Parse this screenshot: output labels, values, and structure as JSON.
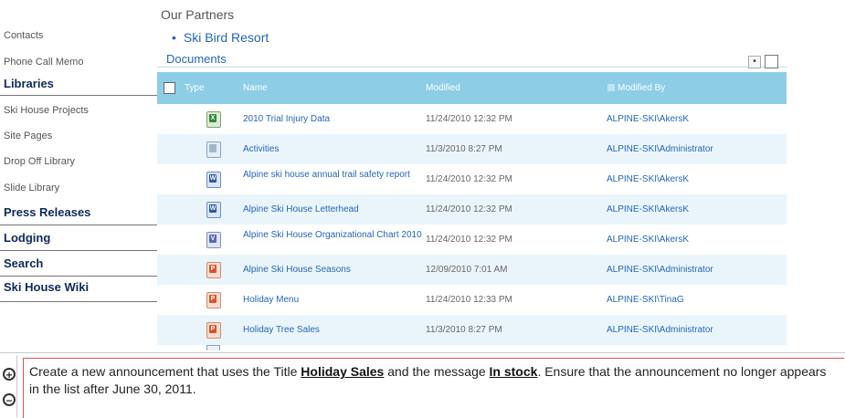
{
  "nav": {
    "contacts": "Contacts",
    "phone_call_memo": "Phone Call Memo",
    "libraries": "Libraries",
    "ski_house_projects": "Ski House Projects",
    "site_pages": "Site Pages",
    "drop_off_library": "Drop Off Library",
    "slide_library": "Slide Library",
    "press_releases": "Press Releases",
    "lodging": "Lodging",
    "search": "Search",
    "ski_house_wiki": "Ski House Wiki"
  },
  "partners": {
    "title": "Our Partners",
    "bullet": "•",
    "link": "Ski Bird Resort"
  },
  "documents": {
    "title": "Documents",
    "dot_control": "•",
    "columns": [
      "Type",
      "Name",
      "Modified",
      "Modified By"
    ],
    "rows": [
      {
        "icon": "excel-file-icon",
        "name": "2010 Trial Injury Data",
        "modified": "11/24/2010 12:32 PM",
        "modified_by": "ALPINE-SKI\\AkersK"
      },
      {
        "icon": "generic-file-icon",
        "name": "Activities",
        "modified": "11/3/2010 8:27 PM",
        "modified_by": "ALPINE-SKI\\Administrator"
      },
      {
        "icon": "word-file-icon",
        "name": "Alpine ski house annual trail safety report",
        "modified": "11/24/2010 12:32 PM",
        "modified_by": "ALPINE-SKI\\AkersK"
      },
      {
        "icon": "word-file-icon",
        "name": "Alpine Ski House Letterhead",
        "modified": "11/24/2010 12:32 PM",
        "modified_by": "ALPINE-SKI\\AkersK"
      },
      {
        "icon": "visio-file-icon",
        "name": "Alpine Ski House Organizational Chart 2010",
        "modified": "11/24/2010 12:32 PM",
        "modified_by": "ALPINE-SKI\\AkersK"
      },
      {
        "icon": "powerpoint-file-icon",
        "name": "Alpine Ski House Seasons",
        "modified": "12/09/2010 7:01 AM",
        "modified_by": "ALPINE-SKI\\Administrator"
      },
      {
        "icon": "powerpoint-file-icon",
        "name": "Holiday Menu",
        "modified": "11/24/2010 12:33 PM",
        "modified_by": "ALPINE-SKI\\TinaG"
      },
      {
        "icon": "powerpoint-file-icon",
        "name": "Holiday Tree Sales",
        "modified": "11/3/2010 8:27 PM",
        "modified_by": "ALPINE-SKI\\Administrator"
      }
    ]
  },
  "task": {
    "text_1": "Create a new announcement that uses the Title ",
    "title_value": "Holiday Sales",
    "text_2": " and the message ",
    "message_value": "In stock",
    "text_3": ". Ensure that the announcement no longer appears in the list after June 30, 2011.",
    "zoom_in": "+",
    "zoom_out": "−"
  },
  "colors": {
    "header_bg": "#8ecde6",
    "link": "#2467b5",
    "alt_row": "#eaf5fb",
    "task_border": "#d9534f"
  }
}
